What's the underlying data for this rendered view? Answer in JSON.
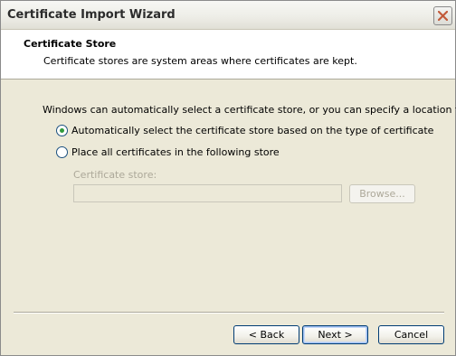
{
  "window": {
    "title": "Certificate Import Wizard",
    "close_icon": "close-icon",
    "close_color": "#c25a3a"
  },
  "header": {
    "title": "Certificate Store",
    "description": "Certificate stores are system areas where certificates are kept."
  },
  "body": {
    "instructions": "Windows can automatically select a certificate store, or you can specify a location for",
    "options": [
      {
        "label": "Automatically select the certificate store based on the type of certificate",
        "selected": true
      },
      {
        "label": "Place all certificates in the following store",
        "selected": false
      }
    ],
    "store_label": "Certificate store:",
    "store_value": "",
    "browse_label": "Browse..."
  },
  "footer": {
    "back_label": "< Back",
    "next_label": "Next >",
    "cancel_label": "Cancel"
  }
}
